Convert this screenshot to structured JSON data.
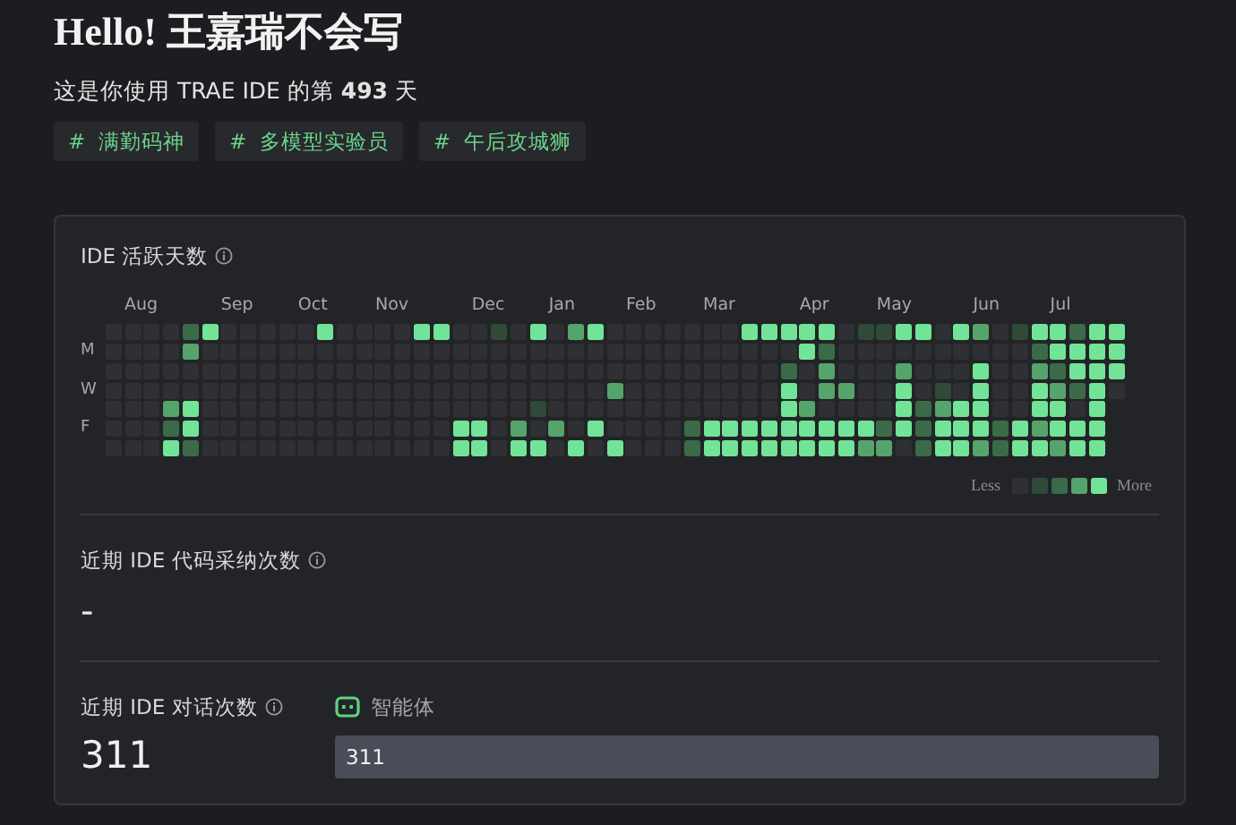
{
  "header": {
    "title": "Hello! 王嘉瑞不会写",
    "subtitle": "这是你使用 TRAE IDE 的第 **493** 天",
    "tags": [
      "#  满勤码神",
      "#  多模型实验员",
      "#  午后攻城狮"
    ]
  },
  "activity": {
    "title": "IDE 活跃天数",
    "weekday_labels": {
      "monday": "M",
      "wednesday": "W",
      "friday": "F"
    },
    "weeks": [
      {
        "days": [
          {
            "color": "#2e3034"
          },
          {
            "color": "#2e3034"
          },
          {
            "color": "#2e3034"
          },
          {
            "color": "#2e3034"
          },
          {
            "color": "#2e3034"
          },
          {
            "color": "#2e3034"
          },
          {
            "color": "#2e3034"
          }
        ]
      },
      {
        "month": "Aug",
        "days": [
          {
            "color": "#2e3034"
          },
          {
            "color": "#2e3034"
          },
          {
            "color": "#2e3034"
          },
          {
            "color": "#2e3034"
          },
          {
            "color": "#2e3034"
          },
          {
            "color": "#2e3034"
          },
          {
            "color": "#2e3034"
          }
        ]
      },
      {
        "days": [
          {
            "color": "#2e3034"
          },
          {
            "color": "#2e3034"
          },
          {
            "color": "#2e3034"
          },
          {
            "color": "#2e3034"
          },
          {
            "color": "#2e3034"
          },
          {
            "color": "#2e3034"
          },
          {
            "color": "#2e3034"
          }
        ]
      },
      {
        "days": [
          {
            "color": "#2e3034"
          },
          {
            "color": "#2e3034"
          },
          {
            "color": "#2e3034"
          },
          {
            "color": "#2e3034"
          },
          {
            "color": "#55a46c"
          },
          {
            "color": "#3b6a48"
          },
          {
            "color": "#72e497"
          }
        ]
      },
      {
        "days": [
          {
            "color": "#3b6a48"
          },
          {
            "color": "#55a46c"
          },
          {
            "color": "#2e3034"
          },
          {
            "color": "#2e3034"
          },
          {
            "color": "#72e497"
          },
          {
            "color": "#72e497"
          },
          {
            "color": "#3b6a48"
          }
        ]
      },
      {
        "days": [
          {
            "color": "#72e497"
          },
          {
            "color": "#2e3034"
          },
          {
            "color": "#2e3034"
          },
          {
            "color": "#2e3034"
          },
          {
            "color": "#2e3034"
          },
          {
            "color": "#2e3034"
          },
          {
            "color": "#2e3034"
          }
        ]
      },
      {
        "month": "Sep",
        "days": [
          {
            "color": "#2e3034"
          },
          {
            "color": "#2e3034"
          },
          {
            "color": "#2e3034"
          },
          {
            "color": "#2e3034"
          },
          {
            "color": "#2e3034"
          },
          {
            "color": "#2e3034"
          },
          {
            "color": "#2e3034"
          }
        ]
      },
      {
        "days": [
          {
            "color": "#2e3034"
          },
          {
            "color": "#2e3034"
          },
          {
            "color": "#2e3034"
          },
          {
            "color": "#2e3034"
          },
          {
            "color": "#2e3034"
          },
          {
            "color": "#2e3034"
          },
          {
            "color": "#2e3034"
          }
        ]
      },
      {
        "days": [
          {
            "color": "#2e3034"
          },
          {
            "color": "#2e3034"
          },
          {
            "color": "#2e3034"
          },
          {
            "color": "#2e3034"
          },
          {
            "color": "#2e3034"
          },
          {
            "color": "#2e3034"
          },
          {
            "color": "#2e3034"
          }
        ]
      },
      {
        "days": [
          {
            "color": "#2e3034"
          },
          {
            "color": "#2e3034"
          },
          {
            "color": "#2e3034"
          },
          {
            "color": "#2e3034"
          },
          {
            "color": "#2e3034"
          },
          {
            "color": "#2e3034"
          },
          {
            "color": "#2e3034"
          }
        ]
      },
      {
        "month": "Oct",
        "days": [
          {
            "color": "#2e3034"
          },
          {
            "color": "#2e3034"
          },
          {
            "color": "#2e3034"
          },
          {
            "color": "#2e3034"
          },
          {
            "color": "#2e3034"
          },
          {
            "color": "#2e3034"
          },
          {
            "color": "#2e3034"
          }
        ]
      },
      {
        "days": [
          {
            "color": "#72e497"
          },
          {
            "color": "#2e3034"
          },
          {
            "color": "#2e3034"
          },
          {
            "color": "#2e3034"
          },
          {
            "color": "#2e3034"
          },
          {
            "color": "#2e3034"
          },
          {
            "color": "#2e3034"
          }
        ]
      },
      {
        "days": [
          {
            "color": "#2e3034"
          },
          {
            "color": "#2e3034"
          },
          {
            "color": "#2e3034"
          },
          {
            "color": "#2e3034"
          },
          {
            "color": "#2e3034"
          },
          {
            "color": "#2e3034"
          },
          {
            "color": "#2e3034"
          }
        ]
      },
      {
        "days": [
          {
            "color": "#2e3034"
          },
          {
            "color": "#2e3034"
          },
          {
            "color": "#2e3034"
          },
          {
            "color": "#2e3034"
          },
          {
            "color": "#2e3034"
          },
          {
            "color": "#2e3034"
          },
          {
            "color": "#2e3034"
          }
        ]
      },
      {
        "month": "Nov",
        "days": [
          {
            "color": "#2e3034"
          },
          {
            "color": "#2e3034"
          },
          {
            "color": "#2e3034"
          },
          {
            "color": "#2e3034"
          },
          {
            "color": "#2e3034"
          },
          {
            "color": "#2e3034"
          },
          {
            "color": "#2e3034"
          }
        ]
      },
      {
        "days": [
          {
            "color": "#2e3034"
          },
          {
            "color": "#2e3034"
          },
          {
            "color": "#2e3034"
          },
          {
            "color": "#2e3034"
          },
          {
            "color": "#2e3034"
          },
          {
            "color": "#2e3034"
          },
          {
            "color": "#2e3034"
          }
        ]
      },
      {
        "days": [
          {
            "color": "#72e497"
          },
          {
            "color": "#2e3034"
          },
          {
            "color": "#2e3034"
          },
          {
            "color": "#2e3034"
          },
          {
            "color": "#2e3034"
          },
          {
            "color": "#2e3034"
          },
          {
            "color": "#2e3034"
          }
        ]
      },
      {
        "days": [
          {
            "color": "#72e497"
          },
          {
            "color": "#2e3034"
          },
          {
            "color": "#2e3034"
          },
          {
            "color": "#2e3034"
          },
          {
            "color": "#2e3034"
          },
          {
            "color": "#2e3034"
          },
          {
            "color": "#2e3034"
          }
        ]
      },
      {
        "days": [
          {
            "color": "#2e3034"
          },
          {
            "color": "#2e3034"
          },
          {
            "color": "#2e3034"
          },
          {
            "color": "#2e3034"
          },
          {
            "color": "#2e3034"
          },
          {
            "color": "#72e497"
          },
          {
            "color": "#72e497"
          }
        ]
      },
      {
        "month": "Dec",
        "days": [
          {
            "color": "#2e3034"
          },
          {
            "color": "#2e3034"
          },
          {
            "color": "#2e3034"
          },
          {
            "color": "#2e3034"
          },
          {
            "color": "#2e3034"
          },
          {
            "color": "#72e497"
          },
          {
            "color": "#72e497"
          }
        ]
      },
      {
        "days": [
          {
            "color": "#2f4a38"
          },
          {
            "color": "#2e3034"
          },
          {
            "color": "#2e3034"
          },
          {
            "color": "#2e3034"
          },
          {
            "color": "#2e3034"
          },
          {
            "color": "#2e3034"
          },
          {
            "color": "#2e3034"
          }
        ]
      },
      {
        "days": [
          {
            "color": "#2e3034"
          },
          {
            "color": "#2e3034"
          },
          {
            "color": "#2e3034"
          },
          {
            "color": "#2e3034"
          },
          {
            "color": "#2e3034"
          },
          {
            "color": "#55a46c"
          },
          {
            "color": "#72e497"
          }
        ]
      },
      {
        "days": [
          {
            "color": "#72e497"
          },
          {
            "color": "#2e3034"
          },
          {
            "color": "#2e3034"
          },
          {
            "color": "#2e3034"
          },
          {
            "color": "#2f4a38"
          },
          {
            "color": "#2e3034"
          },
          {
            "color": "#72e497"
          }
        ]
      },
      {
        "month": "Jan",
        "days": [
          {
            "color": "#2e3034"
          },
          {
            "color": "#2e3034"
          },
          {
            "color": "#2e3034"
          },
          {
            "color": "#2e3034"
          },
          {
            "color": "#2e3034"
          },
          {
            "color": "#55a46c"
          },
          {
            "color": "#2e3034"
          }
        ]
      },
      {
        "days": [
          {
            "color": "#55a46c"
          },
          {
            "color": "#2e3034"
          },
          {
            "color": "#2e3034"
          },
          {
            "color": "#2e3034"
          },
          {
            "color": "#2e3034"
          },
          {
            "color": "#2e3034"
          },
          {
            "color": "#72e497"
          }
        ]
      },
      {
        "days": [
          {
            "color": "#72e497"
          },
          {
            "color": "#2e3034"
          },
          {
            "color": "#2e3034"
          },
          {
            "color": "#2e3034"
          },
          {
            "color": "#2e3034"
          },
          {
            "color": "#72e497"
          },
          {
            "color": "#2e3034"
          }
        ]
      },
      {
        "days": [
          {
            "color": "#2e3034"
          },
          {
            "color": "#2e3034"
          },
          {
            "color": "#2e3034"
          },
          {
            "color": "#55a46c"
          },
          {
            "color": "#2e3034"
          },
          {
            "color": "#2e3034"
          },
          {
            "color": "#72e497"
          }
        ]
      },
      {
        "month": "Feb",
        "days": [
          {
            "color": "#2e3034"
          },
          {
            "color": "#2e3034"
          },
          {
            "color": "#2e3034"
          },
          {
            "color": "#2e3034"
          },
          {
            "color": "#2e3034"
          },
          {
            "color": "#2e3034"
          },
          {
            "color": "#2e3034"
          }
        ]
      },
      {
        "days": [
          {
            "color": "#2e3034"
          },
          {
            "color": "#2e3034"
          },
          {
            "color": "#2e3034"
          },
          {
            "color": "#2e3034"
          },
          {
            "color": "#2e3034"
          },
          {
            "color": "#2e3034"
          },
          {
            "color": "#2e3034"
          }
        ]
      },
      {
        "days": [
          {
            "color": "#2e3034"
          },
          {
            "color": "#2e3034"
          },
          {
            "color": "#2e3034"
          },
          {
            "color": "#2e3034"
          },
          {
            "color": "#2e3034"
          },
          {
            "color": "#2e3034"
          },
          {
            "color": "#2e3034"
          }
        ]
      },
      {
        "days": [
          {
            "color": "#2e3034"
          },
          {
            "color": "#2e3034"
          },
          {
            "color": "#2e3034"
          },
          {
            "color": "#2e3034"
          },
          {
            "color": "#2e3034"
          },
          {
            "color": "#3b6a48"
          },
          {
            "color": "#3b6a48"
          }
        ]
      },
      {
        "month": "Mar",
        "days": [
          {
            "color": "#2e3034"
          },
          {
            "color": "#2e3034"
          },
          {
            "color": "#2e3034"
          },
          {
            "color": "#2e3034"
          },
          {
            "color": "#2e3034"
          },
          {
            "color": "#72e497"
          },
          {
            "color": "#72e497"
          }
        ]
      },
      {
        "days": [
          {
            "color": "#2e3034"
          },
          {
            "color": "#2e3034"
          },
          {
            "color": "#2e3034"
          },
          {
            "color": "#2e3034"
          },
          {
            "color": "#2e3034"
          },
          {
            "color": "#72e497"
          },
          {
            "color": "#72e497"
          }
        ]
      },
      {
        "days": [
          {
            "color": "#72e497"
          },
          {
            "color": "#2e3034"
          },
          {
            "color": "#2e3034"
          },
          {
            "color": "#2e3034"
          },
          {
            "color": "#2e3034"
          },
          {
            "color": "#72e497"
          },
          {
            "color": "#72e497"
          }
        ]
      },
      {
        "days": [
          {
            "color": "#72e497"
          },
          {
            "color": "#2e3034"
          },
          {
            "color": "#2e3034"
          },
          {
            "color": "#2e3034"
          },
          {
            "color": "#2e3034"
          },
          {
            "color": "#72e497"
          },
          {
            "color": "#72e497"
          }
        ]
      },
      {
        "days": [
          {
            "color": "#72e497"
          },
          {
            "color": "#2e3034"
          },
          {
            "color": "#3b6a48"
          },
          {
            "color": "#72e497"
          },
          {
            "color": "#72e497"
          },
          {
            "color": "#72e497"
          },
          {
            "color": "#72e497"
          }
        ]
      },
      {
        "month": "Apr",
        "days": [
          {
            "color": "#72e497"
          },
          {
            "color": "#72e497"
          },
          {
            "color": "#2e3034"
          },
          {
            "color": "#2e3034"
          },
          {
            "color": "#55a46c"
          },
          {
            "color": "#72e497"
          },
          {
            "color": "#72e497"
          }
        ]
      },
      {
        "days": [
          {
            "color": "#72e497"
          },
          {
            "color": "#3b6a48"
          },
          {
            "color": "#55a46c"
          },
          {
            "color": "#55a46c"
          },
          {
            "color": "#2e3034"
          },
          {
            "color": "#72e497"
          },
          {
            "color": "#72e497"
          }
        ]
      },
      {
        "days": [
          {
            "color": "#2e3034"
          },
          {
            "color": "#2e3034"
          },
          {
            "color": "#2e3034"
          },
          {
            "color": "#55a46c"
          },
          {
            "color": "#2e3034"
          },
          {
            "color": "#72e497"
          },
          {
            "color": "#72e497"
          }
        ]
      },
      {
        "days": [
          {
            "color": "#2f4a38"
          },
          {
            "color": "#2e3034"
          },
          {
            "color": "#2e3034"
          },
          {
            "color": "#2e3034"
          },
          {
            "color": "#2e3034"
          },
          {
            "color": "#72e497"
          },
          {
            "color": "#55a46c"
          }
        ]
      },
      {
        "month": "May",
        "days": [
          {
            "color": "#2f4a38"
          },
          {
            "color": "#2e3034"
          },
          {
            "color": "#2e3034"
          },
          {
            "color": "#2e3034"
          },
          {
            "color": "#2e3034"
          },
          {
            "color": "#3b6a48"
          },
          {
            "color": "#55a46c"
          }
        ]
      },
      {
        "days": [
          {
            "color": "#72e497"
          },
          {
            "color": "#2e3034"
          },
          {
            "color": "#55a46c"
          },
          {
            "color": "#72e497"
          },
          {
            "color": "#72e497"
          },
          {
            "color": "#72e497"
          },
          {
            "color": "#2e3034"
          }
        ]
      },
      {
        "days": [
          {
            "color": "#72e497"
          },
          {
            "color": "#2e3034"
          },
          {
            "color": "#2e3034"
          },
          {
            "color": "#2e3034"
          },
          {
            "color": "#3b6a48"
          },
          {
            "color": "#3b6a48"
          },
          {
            "color": "#3b6a48"
          }
        ]
      },
      {
        "days": [
          {
            "color": "#2e3034"
          },
          {
            "color": "#2e3034"
          },
          {
            "color": "#2e3034"
          },
          {
            "color": "#2f4a38"
          },
          {
            "color": "#55a46c"
          },
          {
            "color": "#72e497"
          },
          {
            "color": "#72e497"
          }
        ]
      },
      {
        "days": [
          {
            "color": "#72e497"
          },
          {
            "color": "#2e3034"
          },
          {
            "color": "#2e3034"
          },
          {
            "color": "#2e3034"
          },
          {
            "color": "#72e497"
          },
          {
            "color": "#72e497"
          },
          {
            "color": "#72e497"
          }
        ]
      },
      {
        "month": "Jun",
        "days": [
          {
            "color": "#55a46c"
          },
          {
            "color": "#2e3034"
          },
          {
            "color": "#72e497"
          },
          {
            "color": "#72e497"
          },
          {
            "color": "#72e497"
          },
          {
            "color": "#72e497"
          },
          {
            "color": "#55a46c"
          }
        ]
      },
      {
        "days": [
          {
            "color": "#2e3034"
          },
          {
            "color": "#2e3034"
          },
          {
            "color": "#2e3034"
          },
          {
            "color": "#2e3034"
          },
          {
            "color": "#2e3034"
          },
          {
            "color": "#3b6a48"
          },
          {
            "color": "#3b6a48"
          }
        ]
      },
      {
        "days": [
          {
            "color": "#2f4a38"
          },
          {
            "color": "#2e3034"
          },
          {
            "color": "#2e3034"
          },
          {
            "color": "#2e3034"
          },
          {
            "color": "#2e3034"
          },
          {
            "color": "#72e497"
          },
          {
            "color": "#72e497"
          }
        ]
      },
      {
        "days": [
          {
            "color": "#72e497"
          },
          {
            "color": "#3b6a48"
          },
          {
            "color": "#55a46c"
          },
          {
            "color": "#72e497"
          },
          {
            "color": "#72e497"
          },
          {
            "color": "#55a46c"
          },
          {
            "color": "#72e497"
          }
        ]
      },
      {
        "month": "Jul",
        "days": [
          {
            "color": "#72e497"
          },
          {
            "color": "#72e497"
          },
          {
            "color": "#3b6a48"
          },
          {
            "color": "#55a46c"
          },
          {
            "color": "#72e497"
          },
          {
            "color": "#72e497"
          },
          {
            "color": "#55a46c"
          }
        ]
      },
      {
        "days": [
          {
            "color": "#3b6a48"
          },
          {
            "color": "#72e497"
          },
          {
            "color": "#72e497"
          },
          {
            "color": "#3b6a48"
          },
          {
            "color": "#2e3034"
          },
          {
            "color": "#72e497"
          },
          {
            "color": "#72e497"
          }
        ]
      },
      {
        "days": [
          {
            "color": "#72e497"
          },
          {
            "color": "#72e497"
          },
          {
            "color": "#72e497"
          },
          {
            "color": "#72e497"
          },
          {
            "color": "#72e497"
          },
          {
            "color": "#72e497"
          },
          {
            "color": "#72e497"
          }
        ]
      },
      {
        "days": [
          {
            "color": "#72e497"
          },
          {
            "color": "#72e497"
          },
          {
            "color": "#72e497"
          },
          {
            "color": "#2e3034"
          }
        ]
      }
    ],
    "legend": {
      "less": "Less",
      "swatches": [
        {
          "color": "#2e3034"
        },
        {
          "color": "#2f4a38"
        },
        {
          "color": "#3b6a48"
        },
        {
          "color": "#55a46c"
        },
        {
          "color": "#72e497"
        }
      ],
      "more": "More"
    }
  },
  "adoption": {
    "title": "近期 IDE 代码采纳次数",
    "value": "-"
  },
  "chats": {
    "title": "近期 IDE 对话次数",
    "value": "311",
    "agent_label": "智能体",
    "agent_value": "311"
  }
}
